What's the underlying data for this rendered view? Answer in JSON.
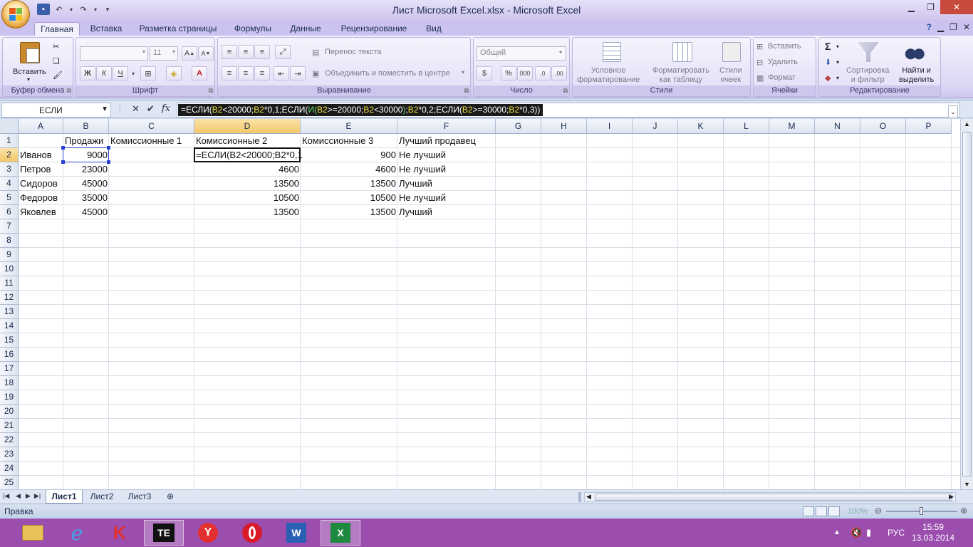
{
  "window": {
    "title": "Лист Microsoft Excel.xlsx - Microsoft Excel"
  },
  "tabs": [
    {
      "label": "Главная",
      "active": true
    },
    {
      "label": "Вставка"
    },
    {
      "label": "Разметка страницы"
    },
    {
      "label": "Формулы"
    },
    {
      "label": "Данные"
    },
    {
      "label": "Рецензирование"
    },
    {
      "label": "Вид"
    }
  ],
  "ribbon": {
    "clipboard": {
      "group": "Буфер обмена",
      "paste": "Вставить"
    },
    "font": {
      "group": "Шрифт",
      "size": "11",
      "bold": "Ж",
      "italic": "К",
      "underline": "Ч"
    },
    "alignment": {
      "group": "Выравнивание",
      "wrap": "Перенос текста",
      "merge": "Объединить и поместить в центре"
    },
    "number": {
      "group": "Число",
      "format": "Общий",
      "percent": "%",
      "thousands": "000"
    },
    "styles": {
      "group": "Стили",
      "conditional": "Условное\nформатирование",
      "table": "Форматировать\nкак таблицу",
      "cell": "Стили\nячеек"
    },
    "cells": {
      "group": "Ячейки",
      "insert": "Вставить",
      "delete": "Удалить",
      "format": "Формат"
    },
    "editing": {
      "group": "Редактирование",
      "sort": "Сортировка\nи фильтр",
      "find": "Найти и\nвыделить"
    }
  },
  "formula_bar": {
    "name_box": "ЕСЛИ",
    "fx": "fx",
    "formula_parts": [
      {
        "t": "=ЕСЛИ(",
        "c": "w"
      },
      {
        "t": "B2",
        "c": "y"
      },
      {
        "t": "<20000;",
        "c": "w"
      },
      {
        "t": "B2",
        "c": "y"
      },
      {
        "t": "*0,1;ЕСЛИ(",
        "c": "w"
      },
      {
        "t": "И(",
        "c": "g"
      },
      {
        "t": "B2",
        "c": "y"
      },
      {
        "t": ">=20000;",
        "c": "w"
      },
      {
        "t": "B2",
        "c": "y"
      },
      {
        "t": "<30000",
        "c": "w"
      },
      {
        "t": ")",
        "c": "g"
      },
      {
        "t": ";",
        "c": "w"
      },
      {
        "t": "B2",
        "c": "y"
      },
      {
        "t": "*0,2;ЕСЛИ(",
        "c": "w"
      },
      {
        "t": "B2",
        "c": "y"
      },
      {
        "t": ">=30000;",
        "c": "w"
      },
      {
        "t": "B2",
        "c": "y"
      },
      {
        "t": "*0,3))",
        "c": "w"
      }
    ]
  },
  "sheet": {
    "columns": [
      "A",
      "B",
      "C",
      "D",
      "E",
      "F",
      "G",
      "H",
      "I",
      "J",
      "K",
      "L",
      "M",
      "N",
      "O",
      "P"
    ],
    "rows": [
      "1",
      "2",
      "3",
      "4",
      "5",
      "6",
      "7",
      "8",
      "9",
      "10",
      "11",
      "12",
      "13",
      "14",
      "15",
      "16",
      "17",
      "18",
      "19",
      "20",
      "21",
      "22",
      "23",
      "24",
      "25"
    ],
    "headers": {
      "B": "Продажи",
      "C": "Комиссионные 1",
      "D": "Комиссионные 2",
      "E": "Комиссионные 3",
      "F": "Лучший продавец"
    },
    "data": [
      {
        "name": "Иванов",
        "sales": "9000",
        "c2": "=ЕСЛИ(B2<20000;B2*0,1",
        "c3": "900",
        "best": "Не лучший"
      },
      {
        "name": "Петров",
        "sales": "23000",
        "c2": "4600",
        "c3": "4600",
        "best": "Не лучший"
      },
      {
        "name": "Сидоров",
        "sales": "45000",
        "c2": "13500",
        "c3": "13500",
        "best": "Лучший"
      },
      {
        "name": "Федоров",
        "sales": "35000",
        "c2": "10500",
        "c3": "10500",
        "best": "Не лучший"
      },
      {
        "name": "Яковлев",
        "sales": "45000",
        "c2": "13500",
        "c3": "13500",
        "best": "Лучший"
      }
    ]
  },
  "sheet_tabs": [
    {
      "label": "Лист1",
      "active": true
    },
    {
      "label": "Лист2"
    },
    {
      "label": "Лист3"
    }
  ],
  "status": {
    "mode": "Правка",
    "zoom": "100%"
  },
  "taskbar": {
    "lang": "РУС",
    "time": "15:59",
    "date": "13.03.2014"
  }
}
